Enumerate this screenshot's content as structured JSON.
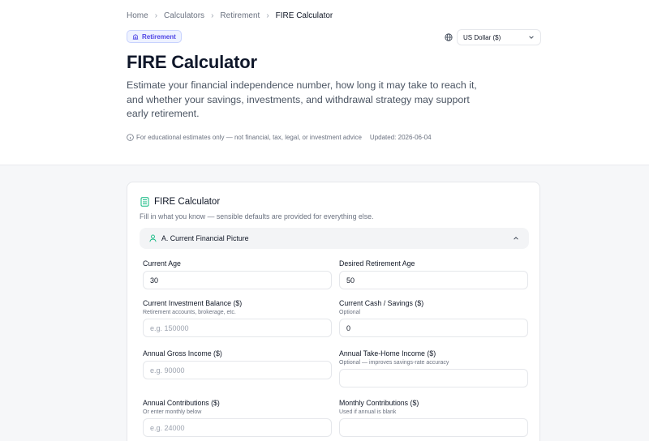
{
  "breadcrumb": {
    "items": [
      "Home",
      "Calculators",
      "Retirement"
    ],
    "current": "FIRE Calculator"
  },
  "badge": {
    "label": "Retirement"
  },
  "currency": {
    "value": "US Dollar ($)"
  },
  "header": {
    "title": "FIRE Calculator",
    "description": "Estimate your financial independence number, how long it may take to reach it, and whether your savings, investments, and withdrawal strategy may support early retirement.",
    "disclaimer": "For educational estimates only — not financial, tax, legal, or investment advice",
    "updated": "Updated: 2026-06-04"
  },
  "card": {
    "title": "FIRE Calculator",
    "subtitle": "Fill in what you know — sensible defaults are provided for everything else.",
    "section": {
      "label": "A. Current Financial Picture"
    },
    "fields": {
      "current_age": {
        "label": "Current Age",
        "value": "30",
        "placeholder": ""
      },
      "retire_age": {
        "label": "Desired Retirement Age",
        "value": "50",
        "placeholder": ""
      },
      "invest_balance": {
        "label": "Current Investment Balance ($)",
        "hint": "Retirement accounts, brokerage, etc.",
        "value": "",
        "placeholder": "e.g. 150000"
      },
      "cash_savings": {
        "label": "Current Cash / Savings ($)",
        "hint": "Optional",
        "value": "0",
        "placeholder": ""
      },
      "gross_income": {
        "label": "Annual Gross Income ($)",
        "value": "",
        "placeholder": "e.g. 90000"
      },
      "take_home": {
        "label": "Annual Take-Home Income ($)",
        "hint": "Optional — improves savings-rate accuracy",
        "value": "",
        "placeholder": ""
      },
      "annual_contrib": {
        "label": "Annual Contributions ($)",
        "hint": "Or enter monthly below",
        "value": "",
        "placeholder": "e.g. 24000"
      },
      "monthly_contrib": {
        "label": "Monthly Contributions ($)",
        "hint": "Used if annual is blank",
        "value": "",
        "placeholder": ""
      }
    }
  },
  "colors": {
    "accent": "#4f46e5",
    "accent_green": "#10b981",
    "page_bg": "#f6f7f9"
  }
}
